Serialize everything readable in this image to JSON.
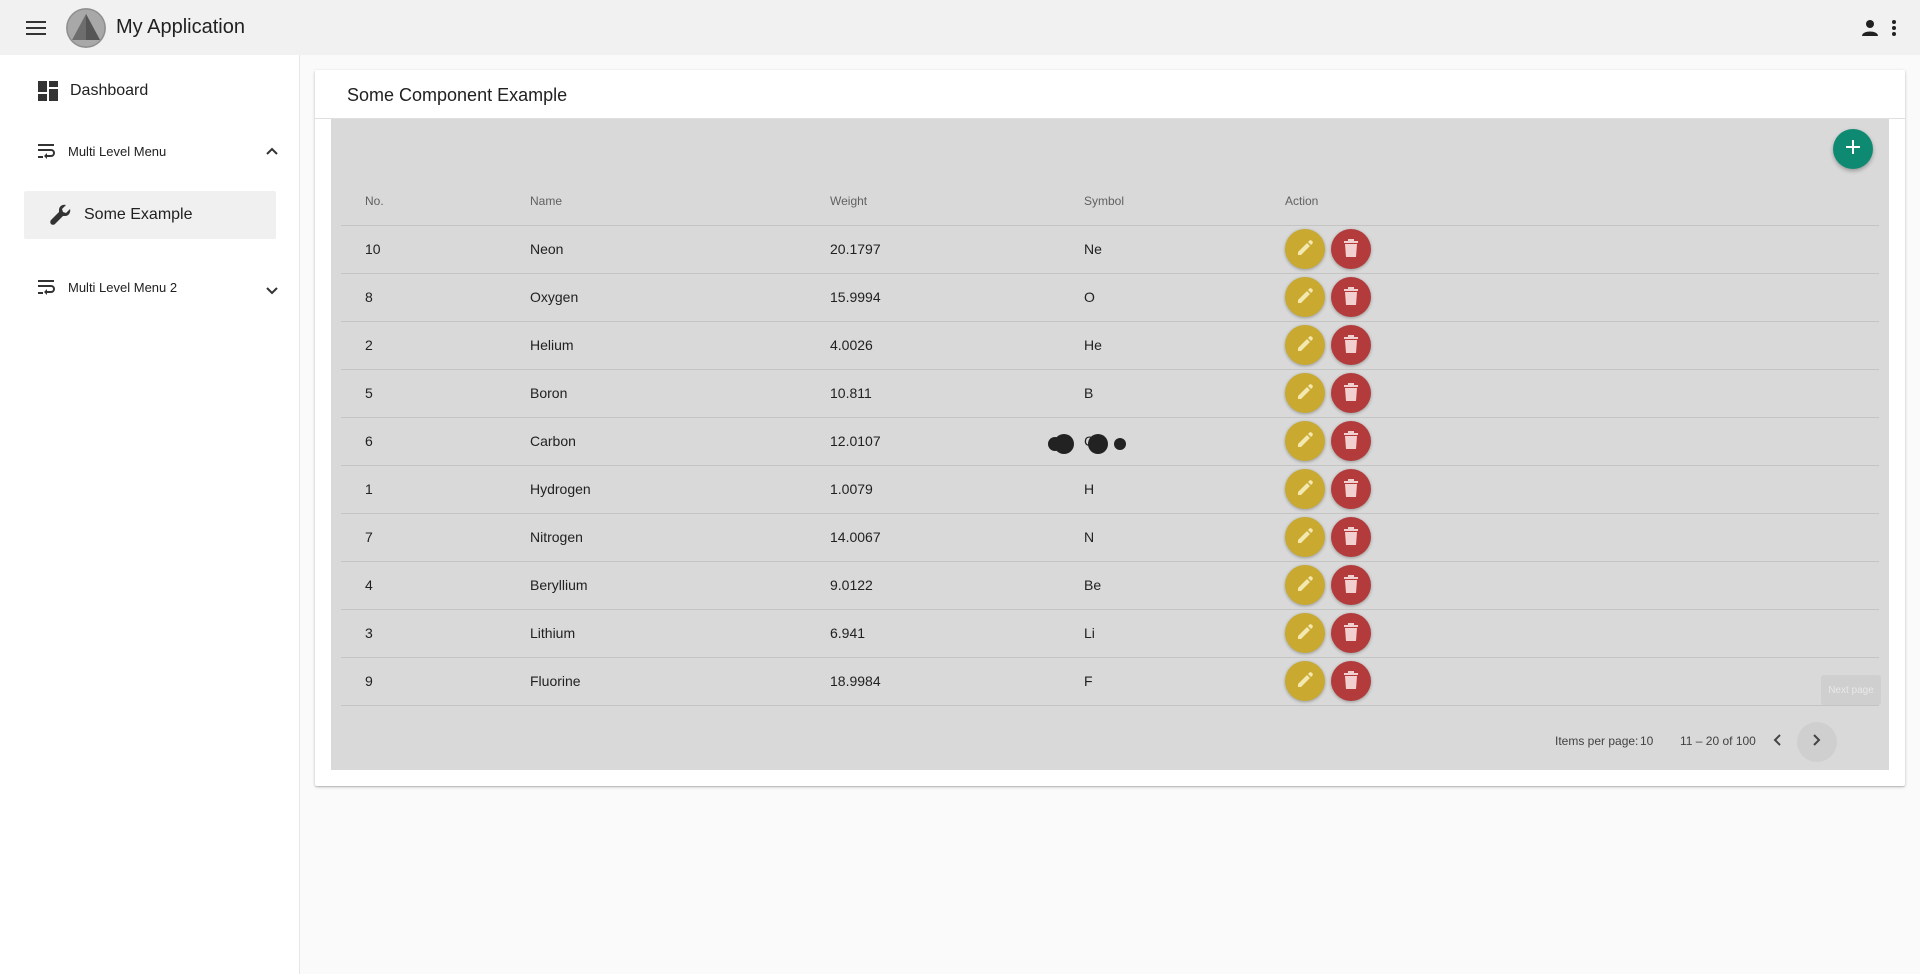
{
  "app": {
    "title": "My Application",
    "menu_icon": "menu-icon",
    "logo_icon": "logo-triangle-icon",
    "account_icon": "account-icon",
    "more_icon": "more-vert-icon"
  },
  "sidebar": {
    "items": [
      {
        "label": "Dashboard",
        "icon": "dashboard-icon"
      },
      {
        "label": "Multi Level Menu",
        "icon": "wrap-text-icon",
        "expanded": true
      },
      {
        "label": "Some Example",
        "icon": "wrench-icon",
        "active": true
      },
      {
        "label": "Multi Level Menu 2",
        "icon": "wrap-text-icon",
        "expanded": false
      }
    ]
  },
  "card": {
    "title": "Some Component Example",
    "add_icon": "add-icon"
  },
  "table": {
    "headers": [
      "No.",
      "Name",
      "Weight",
      "Symbol",
      "Action"
    ],
    "rows": [
      [
        "10",
        "Neon",
        "20.1797",
        "Ne"
      ],
      [
        "8",
        "Oxygen",
        "15.9994",
        "O"
      ],
      [
        "2",
        "Helium",
        "4.0026",
        "He"
      ],
      [
        "5",
        "Boron",
        "10.811",
        "B"
      ],
      [
        "6",
        "Carbon",
        "12.0107",
        "C"
      ],
      [
        "1",
        "Hydrogen",
        "1.0079",
        "H"
      ],
      [
        "7",
        "Nitrogen",
        "14.0067",
        "N"
      ],
      [
        "4",
        "Beryllium",
        "9.0122",
        "Be"
      ],
      [
        "3",
        "Lithium",
        "6.941",
        "Li"
      ],
      [
        "9",
        "Fluorine",
        "18.9984",
        "F"
      ]
    ],
    "edit_icon": "pencil-icon",
    "delete_icon": "trash-icon"
  },
  "paginator": {
    "items_per_page_label": "Items per page:",
    "items_per_page": "10",
    "range": "11 – 20 of 100",
    "next_tooltip": "Next page"
  },
  "colors": {
    "fab": "#0e8a73",
    "edit": "#c9a92f",
    "delete": "#b33b3b",
    "table_bg": "#d9d9d9"
  }
}
